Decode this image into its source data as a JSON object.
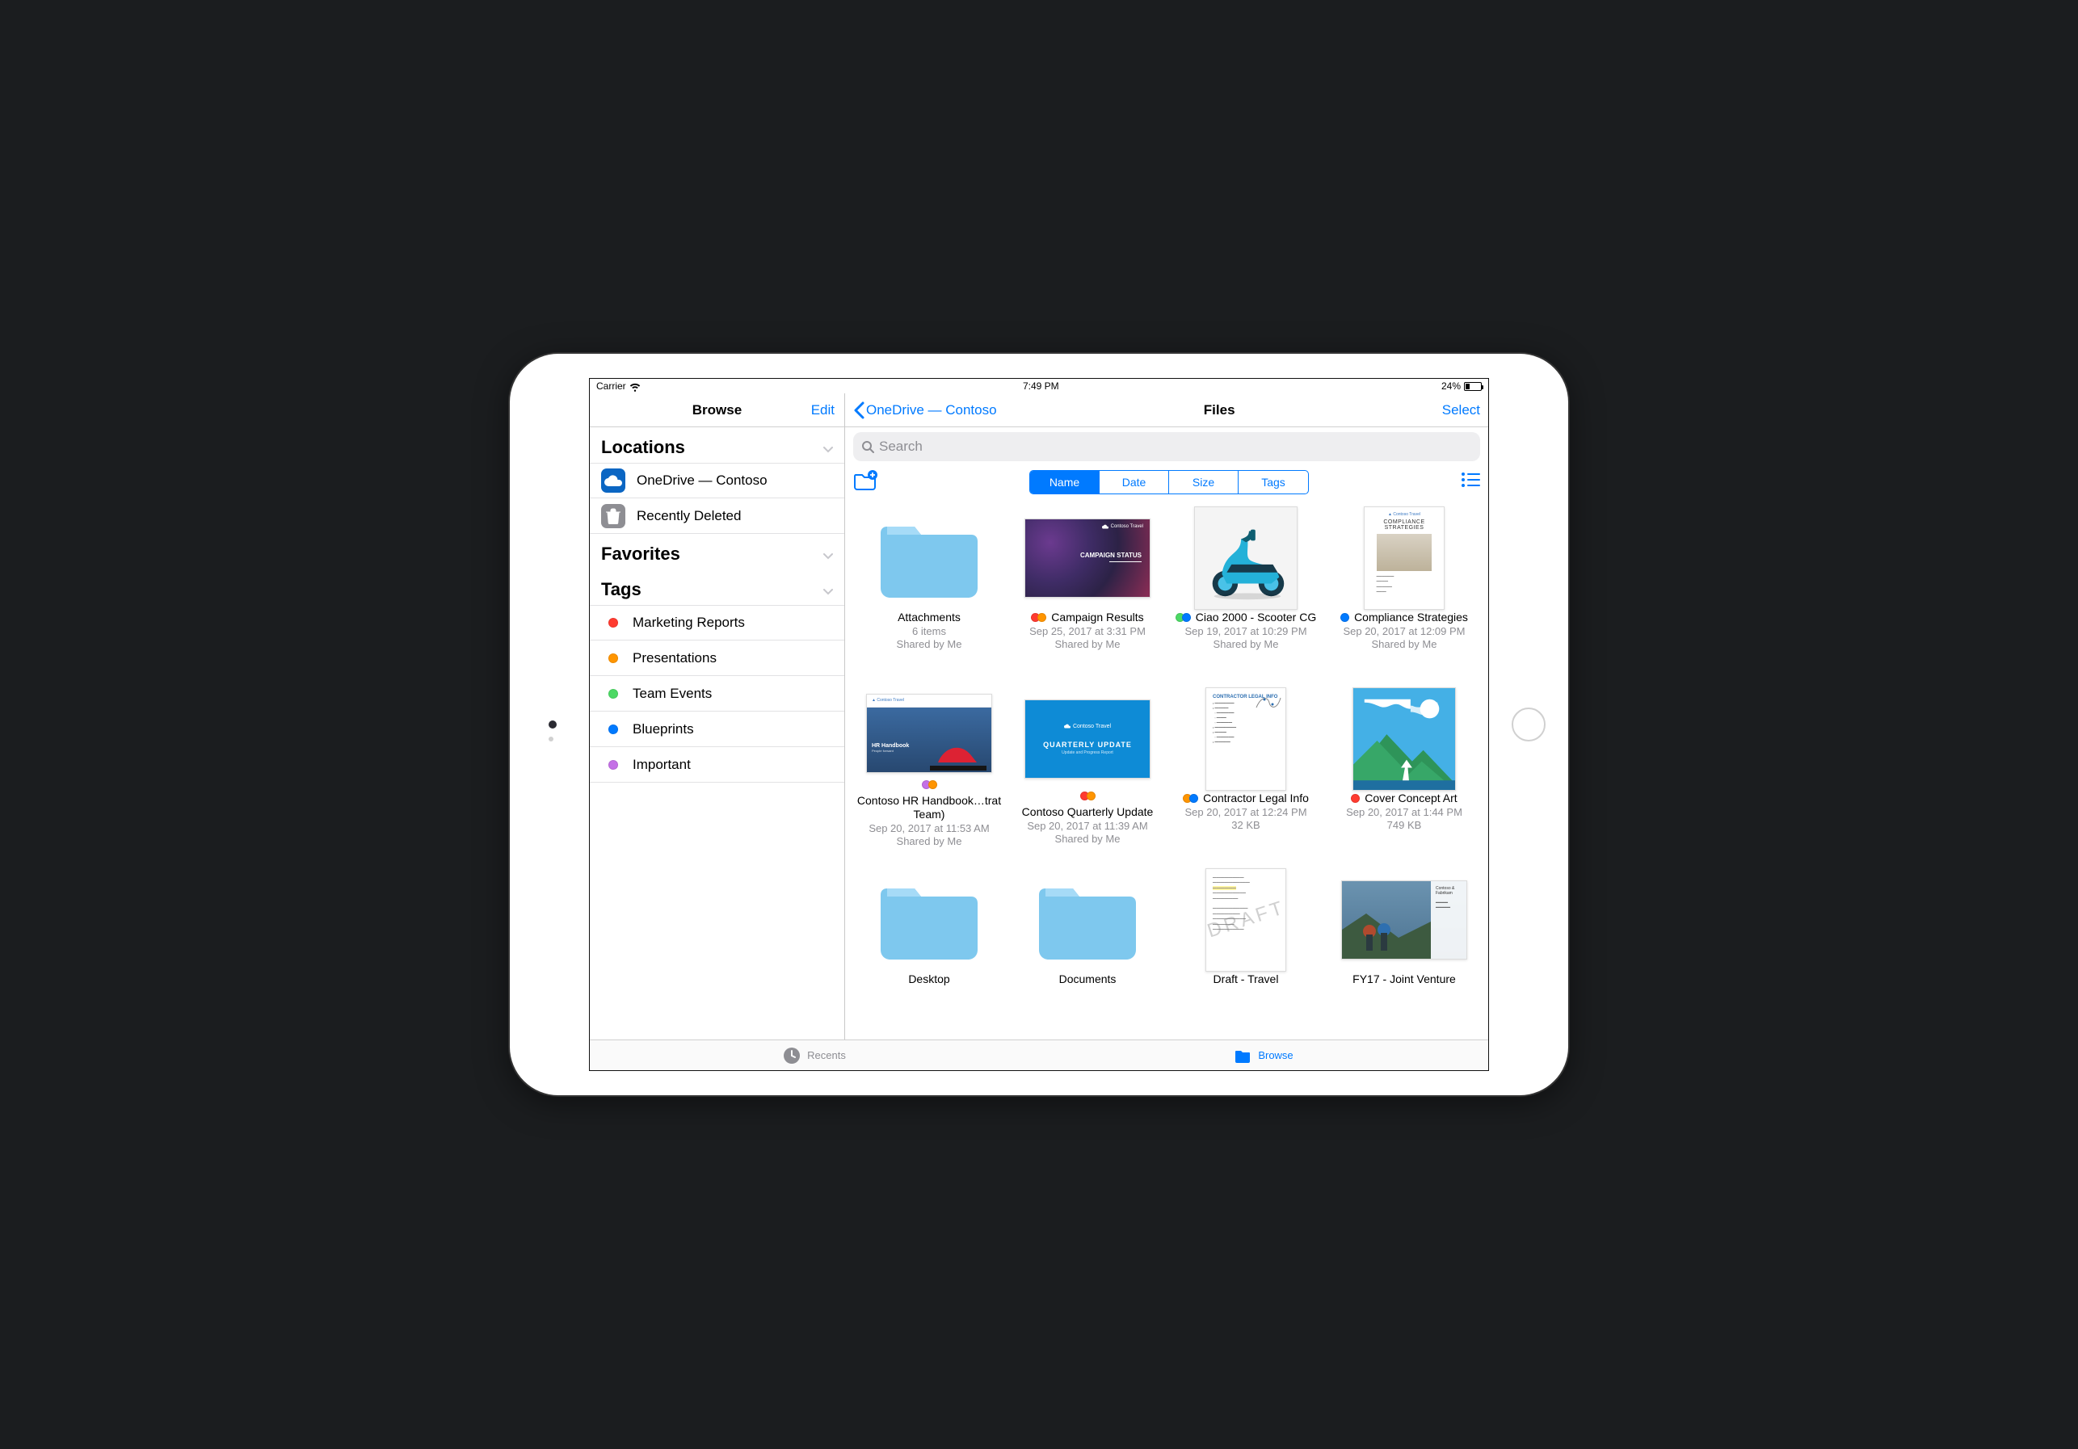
{
  "statusbar": {
    "carrier": "Carrier",
    "time": "7:49 PM",
    "battery_pct": "24%"
  },
  "sidebar": {
    "title": "Browse",
    "edit": "Edit",
    "sections": {
      "locations": {
        "title": "Locations",
        "items": [
          {
            "label": "OneDrive — Contoso"
          },
          {
            "label": "Recently Deleted"
          }
        ]
      },
      "favorites": {
        "title": "Favorites"
      },
      "tags": {
        "title": "Tags",
        "items": [
          {
            "label": "Marketing Reports",
            "color": "#ff3b30"
          },
          {
            "label": "Presentations",
            "color": "#ff9500"
          },
          {
            "label": "Team Events",
            "color": "#4cd964"
          },
          {
            "label": "Blueprints",
            "color": "#007aff"
          },
          {
            "label": "Important",
            "color": "#c470e6"
          }
        ]
      }
    }
  },
  "content": {
    "back_label": "OneDrive — Contoso",
    "title": "Files",
    "select": "Select",
    "search_placeholder": "Search",
    "sort": {
      "options": [
        "Name",
        "Date",
        "Size",
        "Tags"
      ],
      "active": "Name"
    }
  },
  "tabbar": {
    "recents": "Recents",
    "browse": "Browse"
  },
  "files": [
    {
      "name": "Attachments",
      "type": "folder",
      "tags": [],
      "sub1": "6 items",
      "sub2": "Shared by Me"
    },
    {
      "name": "Campaign Results",
      "type": "ppt-campaign",
      "tags": [
        "#ff3b30",
        "#ff9500"
      ],
      "sub1": "Sep 25, 2017 at 3:31 PM",
      "sub2": "Shared by Me"
    },
    {
      "name": "Ciao 2000 - Scooter CG",
      "type": "scooter",
      "tags": [
        "#4cd964",
        "#007aff"
      ],
      "sub1": "Sep 19, 2017 at 10:29 PM",
      "sub2": "Shared by Me"
    },
    {
      "name": "Compliance Strategies",
      "type": "compliance",
      "tags": [
        "#007aff"
      ],
      "sub1": "Sep 20, 2017 at 12:09 PM",
      "sub2": "Shared by Me"
    },
    {
      "name": "Contoso HR Handbook…trat Team)",
      "type": "hr",
      "tags": [
        "#c470e6",
        "#ff9500"
      ],
      "sub1": "Sep 20, 2017 at 11:53 AM",
      "sub2": "Shared by Me"
    },
    {
      "name": "Contoso Quarterly Update",
      "type": "quarterly",
      "tags": [
        "#ff3b30",
        "#ff9500"
      ],
      "sub1": "Sep 20, 2017 at 11:39 AM",
      "sub2": "Shared by Me"
    },
    {
      "name": "Contractor Legal Info",
      "type": "contractor",
      "tags": [
        "#ff9500",
        "#007aff"
      ],
      "sub1": "Sep 20, 2017 at 12:24 PM",
      "sub2": "32 KB"
    },
    {
      "name": "Cover Concept Art",
      "type": "cover",
      "tags": [
        "#ff3b30"
      ],
      "sub1": "Sep 20, 2017 at 1:44 PM",
      "sub2": "749 KB"
    },
    {
      "name": "Desktop",
      "type": "folder",
      "tags": [],
      "sub1": "",
      "sub2": ""
    },
    {
      "name": "Documents",
      "type": "folder",
      "tags": [],
      "sub1": "",
      "sub2": ""
    },
    {
      "name": "Draft - Travel",
      "type": "draft",
      "tags": [],
      "sub1": "",
      "sub2": ""
    },
    {
      "name": "FY17 - Joint Venture",
      "type": "fy17",
      "tags": [],
      "sub1": "",
      "sub2": ""
    }
  ],
  "thumb_text": {
    "brand": "Contoso Travel",
    "campaign_label": "CAMPAIGN STATUS",
    "quarterly_headline": "QUARTERLY UPDATE",
    "quarterly_sub": "Update and Progress Report",
    "hr_title": "HR Handbook",
    "compliance_title": "COMPLIANCE STRATEGIES",
    "contractor_heading": "CONTRACTOR LEGAL INFO",
    "draft_watermark": "DRAFT",
    "fy17_panel": "Contoso & Fabrikam"
  }
}
